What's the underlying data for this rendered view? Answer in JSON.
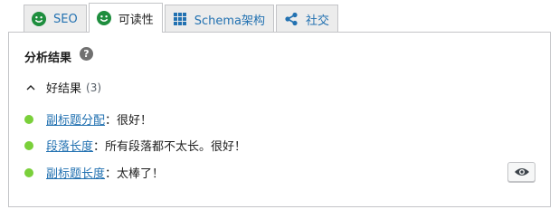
{
  "tabs": [
    {
      "label": "SEO",
      "icon": "seo-smiley-icon",
      "active": false
    },
    {
      "label": "可读性",
      "icon": "readability-smiley-icon",
      "active": true
    },
    {
      "label": "Schema架构",
      "icon": "schema-grid-icon",
      "active": false
    },
    {
      "label": "社交",
      "icon": "share-icon",
      "active": false
    }
  ],
  "panel": {
    "heading": "分析结果",
    "help_glyph": "?",
    "group": {
      "label": "好结果",
      "count": "(3)"
    },
    "results": [
      {
        "link": "副标题分配",
        "text": "：很好！"
      },
      {
        "link": "段落长度",
        "text": "：所有段落都不太长。很好！"
      },
      {
        "link": "副标题长度",
        "text": "：太棒了！"
      }
    ]
  },
  "colors": {
    "good": "#7ad03a",
    "link": "#2271b1",
    "smiley": "#1e8e3e"
  }
}
